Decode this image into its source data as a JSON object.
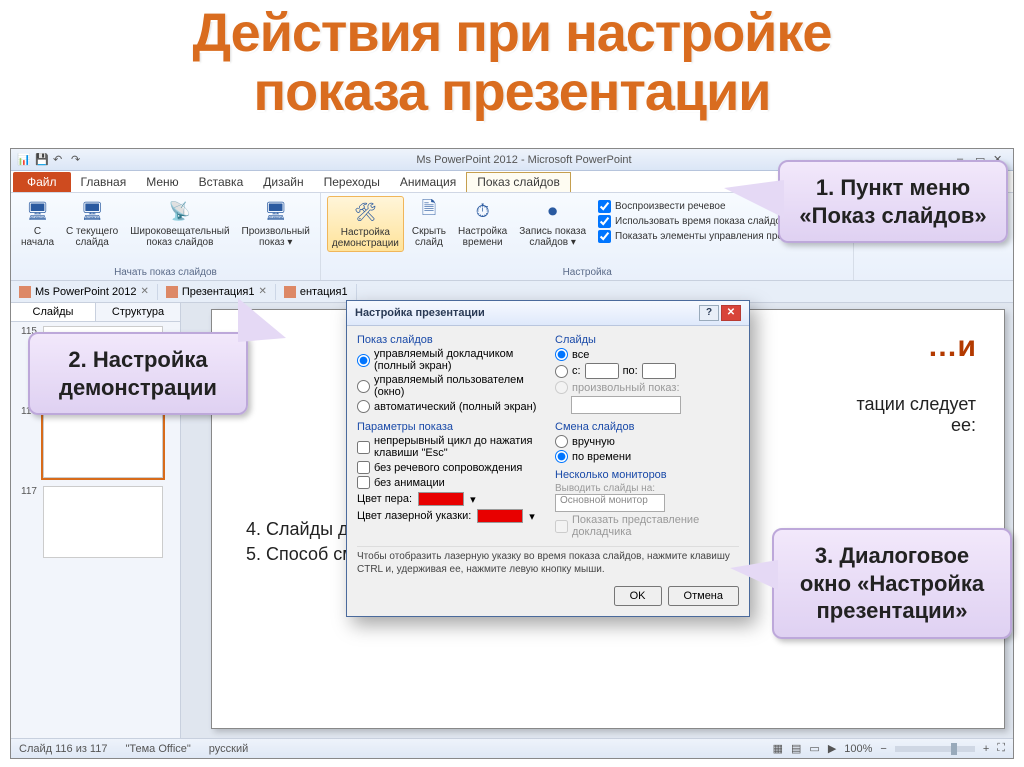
{
  "slide_title_l1": "Действия при настройке",
  "slide_title_l2": "показа презентации",
  "app_title": "Ms PowerPoint 2012  -  Microsoft PowerPoint",
  "help_icon": "?",
  "ribbon_tabs": {
    "file": "Файл",
    "home": "Главная",
    "menu": "Меню",
    "insert": "Вставка",
    "design": "Дизайн",
    "transitions": "Переходы",
    "animations": "Анимация",
    "slideshow": "Показ слайдов"
  },
  "ribbon": {
    "group_start": "Начать показ слайдов",
    "group_setup": "Настройка",
    "btn_from_start": "С\nначала",
    "btn_from_current": "С текущего\nслайда",
    "btn_broadcast": "Широковещательный\nпоказ слайдов",
    "btn_custom": "Произвольный\nпоказ ▾",
    "btn_setup": "Настройка\nдемонстрации",
    "btn_hide": "Скрыть\nслайд",
    "btn_rehearse": "Настройка\nвремени",
    "btn_record": "Запись показа\nслайдов ▾",
    "chk_play_narr": "Воспроизвести речевое",
    "chk_use_timings": "Использовать время показа слайдов",
    "chk_show_controls": "Показать элементы управления проигрывателем"
  },
  "doc_tabs": {
    "t1": "Ms PowerPoint 2012",
    "t2": "Презентация1",
    "t3": "ентация1"
  },
  "pane_tabs": {
    "slides": "Слайды",
    "outline": "Структура"
  },
  "thumb_nums": [
    "115",
    "116",
    "117"
  ],
  "slide_body": {
    "frag1": "тации следует",
    "frag2": "ее:",
    "li4": "Слайды для показа.",
    "li5": "Способ смены слайдов."
  },
  "dialog": {
    "title": "Настройка презентации",
    "g_show": "Показ слайдов",
    "opt_speaker": "управляемый докладчиком (полный экран)",
    "opt_browsed": "управляемый пользователем (окно)",
    "opt_kiosk": "автоматический (полный экран)",
    "g_params": "Параметры показа",
    "chk_loop": "непрерывный цикл до нажатия клавиши \"Esc\"",
    "chk_no_narr": "без речевого сопровождения",
    "chk_no_anim": "без анимации",
    "lbl_pen": "Цвет пера:",
    "lbl_laser": "Цвет лазерной указки:",
    "g_slides": "Слайды",
    "opt_all": "все",
    "opt_range_from": "с:",
    "opt_range_to": "по:",
    "opt_custom": "произвольный показ:",
    "g_advance": "Смена слайдов",
    "opt_manual": "вручную",
    "opt_timings": "по времени",
    "g_monitors": "Несколько мониторов",
    "lbl_mon": "Выводить слайды на:",
    "mon_value": "Основной монитор",
    "chk_presenter": "Показать представление докладчика",
    "note": "Чтобы отобразить лазерную указку во время показа слайдов, нажмите клавишу CTRL и, удерживая ее, нажмите левую кнопку мыши.",
    "ok": "OK",
    "cancel": "Отмена"
  },
  "callouts": {
    "c1": "1. Пункт меню «Показ слайдов»",
    "c2": "2. Настройка демонстрации",
    "c3": "3. Диалоговое окно «Настройка презентации»"
  },
  "status": {
    "slide_of": "Слайд 116 из 117",
    "theme": "\"Тема Office\"",
    "lang": "русский",
    "zoom": "100%"
  }
}
